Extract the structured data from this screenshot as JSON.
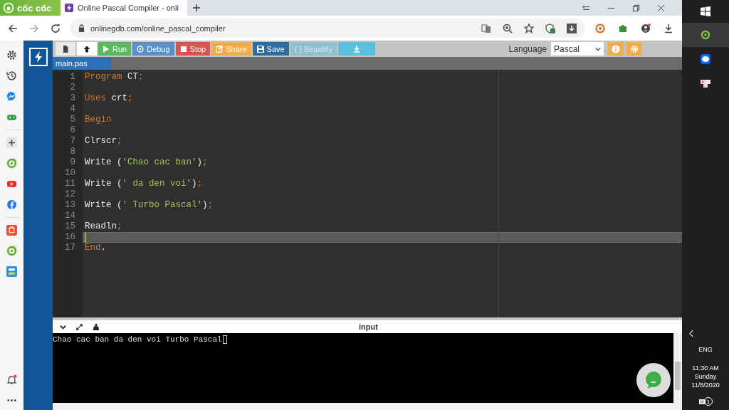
{
  "browser": {
    "brand": "cốc cốc",
    "tab": {
      "title": "Online Pascal Compiler - onli"
    },
    "url": "onlinegdb.com/online_pascal_compiler"
  },
  "sidebar": {
    "items": [
      {
        "kind": "settings"
      },
      {
        "kind": "history"
      },
      {
        "kind": "messenger"
      },
      {
        "kind": "gamepad"
      },
      {
        "kind": "add"
      },
      {
        "kind": "coccoc"
      },
      {
        "kind": "youtube"
      },
      {
        "kind": "facebook"
      },
      {
        "kind": "shop"
      },
      {
        "kind": "coccoc"
      },
      {
        "kind": "tiki"
      }
    ]
  },
  "toolbar": {
    "buttons": [
      {
        "kind": "file",
        "disabled": false
      },
      {
        "kind": "upload",
        "disabled": false
      },
      {
        "kind": "run",
        "label": "Run",
        "disabled": false
      },
      {
        "kind": "debug",
        "label": "Debug",
        "disabled": false
      },
      {
        "kind": "stop",
        "label": "Stop",
        "disabled": false
      },
      {
        "kind": "share",
        "label": "Share",
        "disabled": false
      },
      {
        "kind": "save",
        "label": "Save",
        "disabled": false
      },
      {
        "kind": "beautify",
        "label": "{ } Beautify",
        "disabled": true
      },
      {
        "kind": "download",
        "disabled": false
      }
    ],
    "language_label": "Language",
    "language": "Pascal"
  },
  "file_tabs": [
    {
      "label": "main.pas",
      "selected": true
    }
  ],
  "editor": {
    "lines": [
      {
        "number": "1",
        "active": false,
        "tokens": [
          {
            "kind": "keyword",
            "text": "Program "
          },
          {
            "kind": "plain",
            "text": "CT"
          },
          {
            "kind": "punct",
            "text": ";"
          }
        ]
      },
      {
        "number": "2",
        "active": false
      },
      {
        "number": "3",
        "active": false,
        "tokens": [
          {
            "kind": "keyword",
            "text": "Uses "
          },
          {
            "kind": "plain",
            "text": "crt"
          },
          {
            "kind": "punct",
            "text": ";"
          }
        ]
      },
      {
        "number": "4",
        "active": false
      },
      {
        "number": "5",
        "active": false,
        "tokens": [
          {
            "kind": "keyword",
            "text": "Begin"
          }
        ]
      },
      {
        "number": "6",
        "active": false
      },
      {
        "number": "7",
        "active": false,
        "tokens": [
          {
            "kind": "plain",
            "text": "Clrscr"
          },
          {
            "kind": "punct",
            "text": ";"
          }
        ]
      },
      {
        "number": "8",
        "active": false
      },
      {
        "number": "9",
        "active": false,
        "tokens": [
          {
            "kind": "plain",
            "text": "Write ("
          },
          {
            "kind": "string",
            "text": "'Chao cac ban'"
          },
          {
            "kind": "plain",
            "text": ")"
          },
          {
            "kind": "punct",
            "text": ";"
          }
        ]
      },
      {
        "number": "10",
        "active": false
      },
      {
        "number": "11",
        "active": false,
        "tokens": [
          {
            "kind": "plain",
            "text": "Write ("
          },
          {
            "kind": "string",
            "text": "' da den voi'"
          },
          {
            "kind": "plain",
            "text": ")"
          },
          {
            "kind": "punct",
            "text": ";"
          }
        ]
      },
      {
        "number": "12",
        "active": false
      },
      {
        "number": "13",
        "active": false,
        "tokens": [
          {
            "kind": "plain",
            "text": "Write ("
          },
          {
            "kind": "string",
            "text": "' Turbo Pascal'"
          },
          {
            "kind": "plain",
            "text": ")"
          },
          {
            "kind": "punct",
            "text": ";"
          }
        ]
      },
      {
        "number": "14",
        "active": false
      },
      {
        "number": "15",
        "active": false,
        "tokens": [
          {
            "kind": "plain",
            "text": "Readln"
          },
          {
            "kind": "punct",
            "text": ";"
          }
        ]
      },
      {
        "number": "16",
        "active": true
      },
      {
        "number": "17",
        "active": false,
        "tokens": [
          {
            "kind": "keyword",
            "text": "End"
          },
          {
            "kind": "plain",
            "text": "."
          }
        ]
      }
    ]
  },
  "output": {
    "title": "input",
    "text": "Chao cac ban da den voi Turbo Pascal"
  },
  "taskbar": {
    "language": "ENG",
    "time": "11:30 AM",
    "day": "Sunday",
    "date": "11/8/2020",
    "notifications": "1"
  }
}
